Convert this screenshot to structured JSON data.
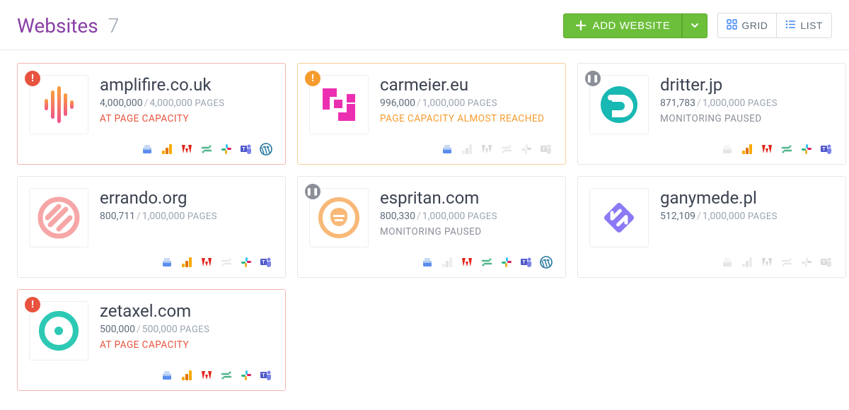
{
  "header": {
    "title": "Websites",
    "count": "7",
    "add_label": "ADD WEBSITE",
    "grid_label": "GRID",
    "list_label": "LIST"
  },
  "pages_label": "PAGES",
  "statuses": {
    "at_capacity": "AT PAGE CAPACITY",
    "almost": "PAGE CAPACITY ALMOST REACHED",
    "paused": "MONITORING PAUSED"
  },
  "integrations": [
    "gsc",
    "ga",
    "adobe",
    "segment",
    "slack",
    "teams",
    "wordpress"
  ],
  "cards": [
    {
      "name": "amplifire.co.uk",
      "pages_current": "4,000,000",
      "pages_max": "4,000,000",
      "status_key": "at_capacity",
      "status_class": "red",
      "border": "red",
      "badge": "alert",
      "logo": "amplifire",
      "active_integrations": [
        "gsc",
        "ga",
        "adobe",
        "segment",
        "slack",
        "teams",
        "wordpress"
      ]
    },
    {
      "name": "carmeier.eu",
      "pages_current": "996,000",
      "pages_max": "1,000,000",
      "status_key": "almost",
      "status_class": "orange",
      "border": "orange",
      "badge": "warn",
      "logo": "carmeier",
      "active_integrations": [
        "gsc"
      ]
    },
    {
      "name": "dritter.jp",
      "pages_current": "871,783",
      "pages_max": "1,000,000",
      "status_key": "paused",
      "status_class": "gray",
      "border": "",
      "badge": "pause",
      "logo": "dritter",
      "active_integrations": [
        "ga",
        "adobe",
        "segment",
        "slack",
        "teams"
      ]
    },
    {
      "name": "errando.org",
      "pages_current": "800,711",
      "pages_max": "1,000,000",
      "status_key": "",
      "status_class": "",
      "border": "",
      "badge": "",
      "logo": "errando",
      "active_integrations": [
        "gsc",
        "ga",
        "adobe",
        "slack",
        "teams"
      ]
    },
    {
      "name": "espritan.com",
      "pages_current": "800,330",
      "pages_max": "1,000,000",
      "status_key": "paused",
      "status_class": "gray",
      "border": "",
      "badge": "pause",
      "logo": "espritan",
      "active_integrations": [
        "gsc",
        "adobe",
        "segment",
        "slack",
        "teams",
        "wordpress"
      ]
    },
    {
      "name": "ganymede.pl",
      "pages_current": "512,109",
      "pages_max": "1,000,000",
      "status_key": "",
      "status_class": "",
      "border": "",
      "badge": "",
      "logo": "ganymede",
      "active_integrations": []
    },
    {
      "name": "zetaxel.com",
      "pages_current": "500,000",
      "pages_max": "500,000",
      "status_key": "at_capacity",
      "status_class": "red",
      "border": "red",
      "badge": "alert",
      "logo": "zetaxel",
      "active_integrations": [
        "gsc",
        "ga",
        "adobe",
        "segment",
        "slack",
        "teams"
      ]
    }
  ]
}
